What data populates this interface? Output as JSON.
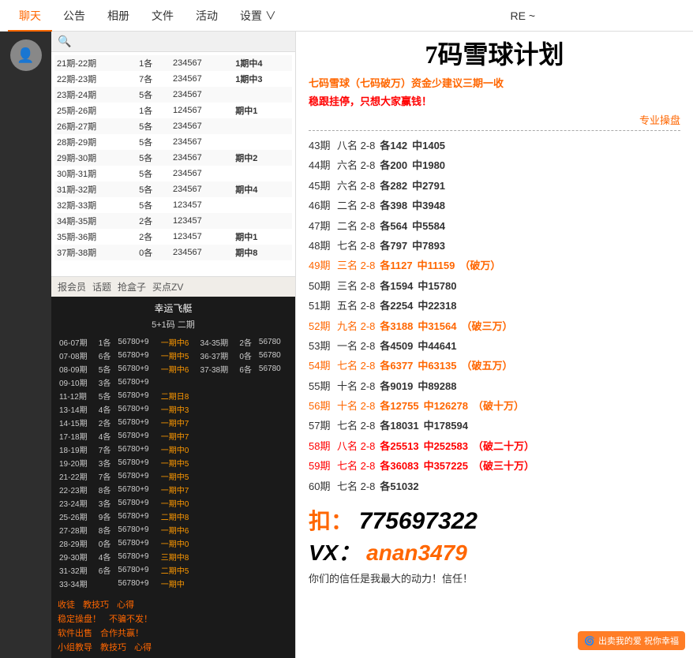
{
  "nav": {
    "items": [
      {
        "label": "聊天",
        "active": true
      },
      {
        "label": "公告",
        "active": false
      },
      {
        "label": "相册",
        "active": false
      },
      {
        "label": "文件",
        "active": false
      },
      {
        "label": "活动",
        "active": false
      },
      {
        "label": "设置 ∨",
        "active": false
      }
    ],
    "re_label": "RE ~"
  },
  "chat": {
    "table_rows": [
      {
        "period": "21期-22期",
        "count": "1各",
        "nums": "234567",
        "result": "1期中4"
      },
      {
        "period": "22期-23期",
        "count": "7各",
        "nums": "234567",
        "result": "1期中3"
      },
      {
        "period": "23期-24期",
        "count": "5各",
        "nums": "234567",
        "result": ""
      },
      {
        "period": "25期-26期",
        "count": "1各",
        "nums": "124567",
        "result": "期中1"
      },
      {
        "period": "26期-27期",
        "count": "5各",
        "nums": "234567",
        "result": ""
      },
      {
        "period": "28期-29期",
        "count": "5各",
        "nums": "234567",
        "result": ""
      },
      {
        "period": "29期-30期",
        "count": "5各",
        "nums": "234567",
        "result": "期中2"
      },
      {
        "period": "30期-31期",
        "count": "5各",
        "nums": "234567",
        "result": ""
      },
      {
        "period": "31期-32期",
        "count": "5各",
        "nums": "234567",
        "result": "期中4"
      },
      {
        "period": "32期-33期",
        "count": "5各",
        "nums": "123457",
        "result": ""
      },
      {
        "period": "34期-35期",
        "count": "2各",
        "nums": "123457",
        "result": ""
      },
      {
        "period": "35期-36期",
        "count": "2各",
        "nums": "123457",
        "result": "期中1"
      },
      {
        "period": "37期-38期",
        "count": "0各",
        "nums": "234567",
        "result": "期中8"
      }
    ],
    "toolbar_items": [
      "报会员",
      "话题",
      "抢盒子",
      "买点ZV"
    ]
  },
  "lucky": {
    "title": "幸运飞艇",
    "subtitle": "5+1码 二期",
    "rows": [
      {
        "period": "06-07期",
        "count": "1各",
        "nums": "56780+9",
        "extra": "一期中6",
        "period2": "34-35期",
        "count2": "2各",
        "nums2": "56780"
      },
      {
        "period": "07-08期",
        "count": "6各",
        "nums": "56780+9",
        "extra": "一期中5",
        "period2": "36-37期",
        "count2": "0各",
        "nums2": "56780"
      },
      {
        "period": "08-09期",
        "count": "5各",
        "nums": "56780+9",
        "extra": "一期中6",
        "period2": "37-38期",
        "count2": "6各",
        "nums2": "56780"
      },
      {
        "period": "09-10期",
        "count": "3各",
        "nums": "56780+9",
        "extra": ""
      },
      {
        "period": "11-12期",
        "count": "5各",
        "nums": "56780+9",
        "extra": "二期日8"
      },
      {
        "period": "13-14期",
        "count": "4各",
        "nums": "56780+9",
        "extra": "一期中3"
      },
      {
        "period": "14-15期",
        "count": "2各",
        "nums": "56780+9",
        "extra": "一期中7"
      },
      {
        "period": "17-18期",
        "count": "4各",
        "nums": "56780+9",
        "extra": "一期中7"
      },
      {
        "period": "18-19期",
        "count": "7各",
        "nums": "56780+9",
        "extra": "一期中0"
      },
      {
        "period": "19-20期",
        "count": "3各",
        "nums": "56780+9",
        "extra": "一期中5"
      },
      {
        "period": "21-22期",
        "count": "7各",
        "nums": "56780+9",
        "extra": "一期中5"
      },
      {
        "period": "22-23期",
        "count": "8各",
        "nums": "56780+9",
        "extra": "一期中7"
      },
      {
        "period": "23-24期",
        "count": "3各",
        "nums": "56780+9",
        "extra": "一期中0"
      },
      {
        "period": "25-26期",
        "count": "9各",
        "nums": "56780+9",
        "extra": "二期中8"
      },
      {
        "period": "27-28期",
        "count": "8各",
        "nums": "56780+9",
        "extra": "一期中6"
      },
      {
        "period": "28-29期",
        "count": "0各",
        "nums": "56780+9",
        "extra": "一期中0"
      },
      {
        "period": "29-30期",
        "count": "4各",
        "nums": "56780+9",
        "extra": "三期中8"
      },
      {
        "period": "31-32期",
        "count": "6各",
        "nums": "56780+9",
        "extra": "二期中5"
      },
      {
        "period": "33-34期",
        "count": "",
        "nums": "56780+9",
        "extra": "一期中"
      }
    ]
  },
  "lucky_bottom": {
    "rows": [
      [
        "收徒",
        "教技巧",
        "心得"
      ],
      [
        "稳定操盘！",
        "不骗不发！"
      ],
      [
        "软件出售",
        "合作共赢！"
      ],
      [
        "小组教导",
        "教技巧",
        "心得"
      ]
    ]
  },
  "right": {
    "title": "7码雪球计划",
    "intro_line1": "七码雪球（七码破万）资金少建议三期一收",
    "intro_line2": "稳跟挂停，只想大家赢钱！",
    "pro_label": "专业操盘",
    "results": [
      {
        "period": "43期",
        "name": "八名",
        "range": "2-8",
        "each": "各142",
        "hit": "中1405",
        "special": ""
      },
      {
        "period": "44期",
        "name": "六名",
        "range": "2-8",
        "each": "各200",
        "hit": "中1980",
        "special": ""
      },
      {
        "period": "45期",
        "name": "六名",
        "range": "2-8",
        "each": "各282",
        "hit": "中2791",
        "special": ""
      },
      {
        "period": "46期",
        "name": "二名",
        "range": "2-8",
        "each": "各398",
        "hit": "中3948",
        "special": ""
      },
      {
        "period": "47期",
        "name": "二名",
        "range": "2-8",
        "each": "各564",
        "hit": "中5584",
        "special": ""
      },
      {
        "period": "48期",
        "name": "七名",
        "range": "2-8",
        "each": "各797",
        "hit": "中7893",
        "special": ""
      },
      {
        "period": "49期",
        "name": "三名",
        "range": "2-8",
        "each": "各1127",
        "hit": "中11159",
        "special": "（破万）"
      },
      {
        "period": "50期",
        "name": "三名",
        "range": "2-8",
        "each": "各1594",
        "hit": "中15780",
        "special": ""
      },
      {
        "period": "51期",
        "name": "五名",
        "range": "2-8",
        "each": "各2254",
        "hit": "中22318",
        "special": ""
      },
      {
        "period": "52期",
        "name": "九名",
        "range": "2-8",
        "each": "各3188",
        "hit": "中31564",
        "special": "（破三万）"
      },
      {
        "period": "53期",
        "name": "一名",
        "range": "2-8",
        "each": "各4509",
        "hit": "中44641",
        "special": ""
      },
      {
        "period": "54期",
        "name": "七名",
        "range": "2-8",
        "each": "各6377",
        "hit": "中63135",
        "special": "（破五万）"
      },
      {
        "period": "55期",
        "name": "十名",
        "range": "2-8",
        "each": "各9019",
        "hit": "中89288",
        "special": ""
      },
      {
        "period": "56期",
        "name": "十名",
        "range": "2-8",
        "each": "各12755",
        "hit": "中126278",
        "special": "（破十万）"
      },
      {
        "period": "57期",
        "name": "七名",
        "range": "2-8",
        "each": "各18031",
        "hit": "中178594",
        "special": ""
      },
      {
        "period": "58期",
        "name": "八名",
        "range": "2-8",
        "each": "各25513",
        "hit": "中252583",
        "special": "（破二十万）"
      },
      {
        "period": "59期",
        "name": "七名",
        "range": "2-8",
        "each": "各36083",
        "hit": "中357225",
        "special": "（破三十万）"
      },
      {
        "period": "60期",
        "name": "七名",
        "range": "2-8",
        "each": "各51032",
        "hit": "",
        "special": ""
      }
    ],
    "contact_qq_label": "扣：",
    "contact_qq": "775697322",
    "contact_vx_label": "VX：",
    "contact_vx": "anan3479",
    "footer_text": "你们的信任是我最大的动力！信任！",
    "watermark": "出卖我的爱 祝你幸福"
  }
}
